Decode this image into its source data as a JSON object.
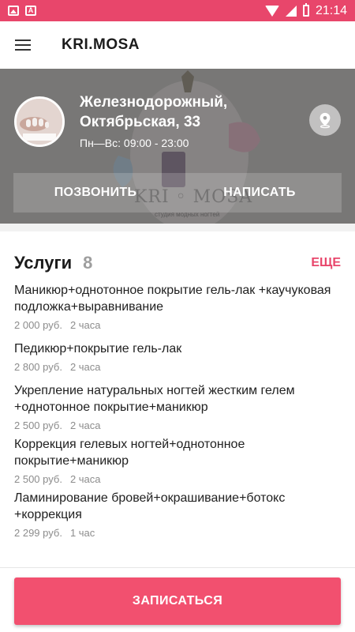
{
  "status_bar": {
    "time": "21:14",
    "icons": [
      "image-icon",
      "a-icon",
      "wifi-icon",
      "signal-icon",
      "battery-icon"
    ],
    "background": "#e8466b"
  },
  "app_bar": {
    "title": "KRI.MOSA",
    "menu_icon": "hamburger-menu-icon"
  },
  "salon": {
    "address_line1": "Железнодорожный,",
    "address_line2": "Октябрьская, 33",
    "hours": "Пн—Вс: 09:00 - 23:00",
    "call_label": "ПОЗВОНИТЬ",
    "message_label": "НАПИСАТЬ",
    "map_icon": "map-pin-icon",
    "watermark": "KRI ◦ MOSA",
    "watermark_sub": "студия модных ногтей"
  },
  "services": {
    "title": "Услуги",
    "count": "8",
    "more_label": "ЕЩЕ",
    "items": [
      {
        "name": "Маникюр+однотонное покрытие гель-лак +каучуковая подложка+выравнивание",
        "price": "2 000 руб.",
        "duration": "2 часа"
      },
      {
        "name": "Педикюр+покрытие гель-лак",
        "price": "2 800 руб.",
        "duration": "2 часа"
      },
      {
        "name": "Укрепление натуральных ногтей жестким гелем +однотонное покрытие+маникюр",
        "price": "2 500 руб.",
        "duration": "2 часа"
      },
      {
        "name": "Коррекция гелевых ногтей+однотонное покрытие+маникюр",
        "price": "2 500 руб.",
        "duration": "2 часа"
      },
      {
        "name": "Ламинирование бровей+окрашивание+ботокс +коррекция",
        "price": "2 299 руб.",
        "duration": "1 час"
      }
    ]
  },
  "book_button": {
    "label": "ЗАПИСАТЬСЯ"
  },
  "colors": {
    "accent": "#e8466b",
    "button": "#f2506f"
  }
}
